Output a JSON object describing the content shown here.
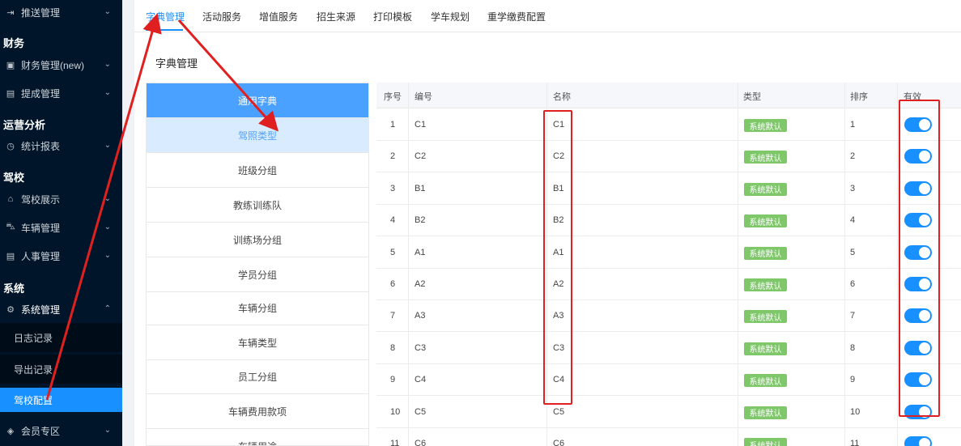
{
  "sidebar": {
    "items": {
      "push": {
        "label": "推送管理",
        "icon": "push-icon"
      },
      "finance_mgmt": {
        "label": "财务管理(new)",
        "icon": "wallet-icon"
      },
      "commission": {
        "label": "提成管理",
        "icon": "document-icon"
      },
      "stats": {
        "label": "统计报表",
        "icon": "clock-icon"
      },
      "school_show": {
        "label": "驾校展示",
        "icon": "home-icon"
      },
      "vehicle": {
        "label": "车辆管理",
        "icon": "car-icon"
      },
      "hr": {
        "label": "人事管理",
        "icon": "document-icon"
      },
      "system_mgmt": {
        "label": "系统管理",
        "icon": "gear-icon"
      },
      "member": {
        "label": "会员专区",
        "icon": "diamond-icon"
      }
    },
    "groups": {
      "finance": "财务",
      "ops": "运营分析",
      "school": "驾校",
      "system": "系统"
    },
    "sub_items": {
      "log": "日志记录",
      "export": "导出记录",
      "school_config": "驾校配置"
    }
  },
  "tabs": [
    "字典管理",
    "活动服务",
    "增值服务",
    "招生来源",
    "打印模板",
    "学车规划",
    "重学缴费配置"
  ],
  "page_title": "字典管理",
  "dict_list": [
    "通用字典",
    "驾照类型",
    "班级分组",
    "教练训练队",
    "训练场分组",
    "学员分组",
    "车辆分组",
    "车辆类型",
    "员工分组",
    "车辆费用款项",
    "车辆用途"
  ],
  "table": {
    "columns": [
      "序号",
      "编号",
      "名称",
      "类型",
      "排序",
      "有效"
    ],
    "type_tag": "系统默认",
    "rows": [
      {
        "idx": "1",
        "code": "C1",
        "name": "C1",
        "sort": "1",
        "enabled": true
      },
      {
        "idx": "2",
        "code": "C2",
        "name": "C2",
        "sort": "2",
        "enabled": true
      },
      {
        "idx": "3",
        "code": "B1",
        "name": "B1",
        "sort": "3",
        "enabled": true
      },
      {
        "idx": "4",
        "code": "B2",
        "name": "B2",
        "sort": "4",
        "enabled": true
      },
      {
        "idx": "5",
        "code": "A1",
        "name": "A1",
        "sort": "5",
        "enabled": true
      },
      {
        "idx": "6",
        "code": "A2",
        "name": "A2",
        "sort": "6",
        "enabled": true
      },
      {
        "idx": "7",
        "code": "A3",
        "name": "A3",
        "sort": "7",
        "enabled": true
      },
      {
        "idx": "8",
        "code": "C3",
        "name": "C3",
        "sort": "8",
        "enabled": true
      },
      {
        "idx": "9",
        "code": "C4",
        "name": "C4",
        "sort": "9",
        "enabled": true
      },
      {
        "idx": "10",
        "code": "C5",
        "name": "C5",
        "sort": "10",
        "enabled": true
      },
      {
        "idx": "11",
        "code": "C6",
        "name": "C6",
        "sort": "11",
        "enabled": true
      }
    ]
  },
  "colors": {
    "sidebar_bg": "#001529",
    "accent": "#1890ff",
    "tag_green": "#7ec86a",
    "annotation_red": "#e02020"
  }
}
